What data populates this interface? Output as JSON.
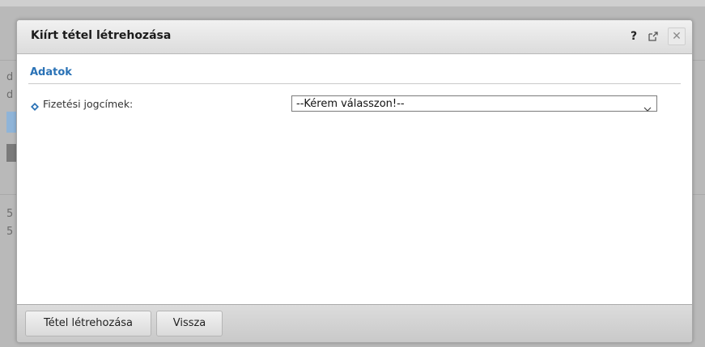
{
  "dialog": {
    "title": "Kiírt tétel létrehozása",
    "help_label": "?",
    "close_label": "✕",
    "section_title": "Adatok",
    "fields": [
      {
        "label": "Fizetési jogcímek:",
        "selected_value": "--Kérem válasszon!--"
      }
    ],
    "buttons": {
      "create_label": "Tétel létrehozása",
      "back_label": "Vissza"
    }
  },
  "background_fragments": [
    "d",
    "d",
    "5",
    "5"
  ],
  "colors": {
    "section_title": "#2a72b6",
    "title_bar": "#dcdcdc",
    "footer": "#c9c9c9",
    "accent_icon": "#2a72b6"
  },
  "icons": {
    "field_marker": "diamond-bullet-icon",
    "popout": "popout-icon",
    "close": "close-icon",
    "dropdown": "chevron-down-icon"
  }
}
